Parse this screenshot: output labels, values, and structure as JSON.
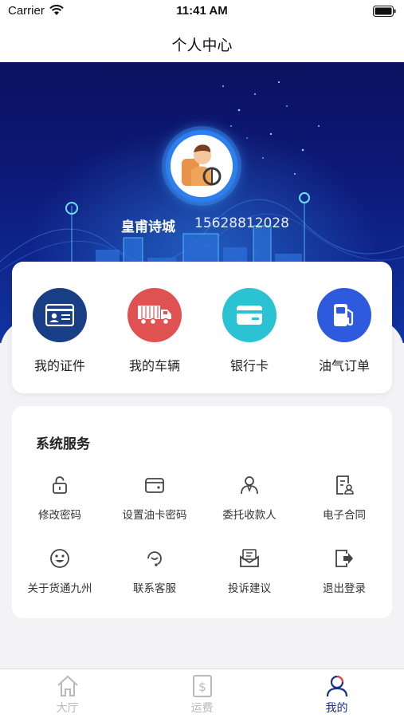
{
  "status_bar": {
    "carrier": "Carrier",
    "time": "11:41 AM"
  },
  "nav": {
    "title": "个人中心"
  },
  "profile": {
    "name": "皇甫诗城",
    "phone": "15628812028"
  },
  "quick_actions": [
    {
      "label": "我的证件",
      "icon": "id-card-icon",
      "color": "#183f86"
    },
    {
      "label": "我的车辆",
      "icon": "truck-icon",
      "color": "#e05252"
    },
    {
      "label": "银行卡",
      "icon": "bank-card-icon",
      "color": "#2bc3d3"
    },
    {
      "label": "油气订单",
      "icon": "fuel-pump-icon",
      "color": "#2e5ade"
    }
  ],
  "services": {
    "title": "系统服务",
    "items": [
      {
        "label": "修改密码",
        "icon": "lock-icon"
      },
      {
        "label": "设置油卡密码",
        "icon": "wallet-icon"
      },
      {
        "label": "委托收款人",
        "icon": "person-icon"
      },
      {
        "label": "电子合同",
        "icon": "contract-icon"
      },
      {
        "label": "关于货通九州",
        "icon": "smiley-icon"
      },
      {
        "label": "联系客服",
        "icon": "headset-icon"
      },
      {
        "label": "投诉建议",
        "icon": "feedback-icon"
      },
      {
        "label": "退出登录",
        "icon": "logout-icon"
      }
    ]
  },
  "tabs": [
    {
      "label": "大厅",
      "icon": "home-icon",
      "active": false
    },
    {
      "label": "运费",
      "icon": "freight-icon",
      "active": false
    },
    {
      "label": "我的",
      "icon": "profile-icon",
      "active": true
    }
  ],
  "colors": {
    "tab_active": "#1b2f86",
    "tab_inactive": "#b9b9b9",
    "hero_dark": "#0b1160",
    "hero_light": "#1034a2"
  }
}
